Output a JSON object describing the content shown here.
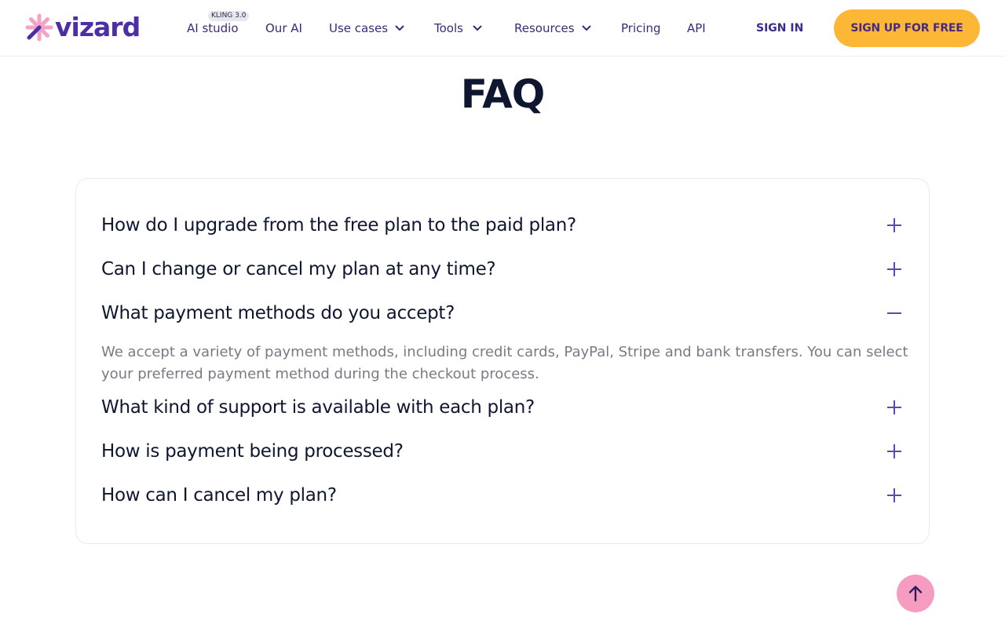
{
  "brand": {
    "name": "vizard",
    "logo_color": "#f3a3c4",
    "text_color": "#4b2ea8"
  },
  "nav": {
    "items": [
      {
        "label": "AI studio",
        "badge": "KLING 3.0",
        "has_dropdown": false
      },
      {
        "label": "Our AI",
        "has_dropdown": false
      },
      {
        "label": "Use cases",
        "has_dropdown": true
      },
      {
        "label": "Tools",
        "has_dropdown": true
      },
      {
        "label": "Resources",
        "has_dropdown": true
      },
      {
        "label": "Pricing",
        "has_dropdown": false
      },
      {
        "label": "API",
        "has_dropdown": false
      }
    ],
    "sign_in": "SIGN IN",
    "sign_up": "SIGN UP FOR FREE",
    "sign_up_color": "#fcb737"
  },
  "faq": {
    "title": "FAQ",
    "items": [
      {
        "question": "How do I upgrade from the free plan to the paid plan?",
        "expanded": false
      },
      {
        "question": "Can I change or cancel my plan at any time?",
        "expanded": false
      },
      {
        "question": "What payment methods do you accept?",
        "expanded": true,
        "answer": "We accept a variety of payment methods, including credit cards, PayPal, Stripe and bank transfers. You can select your preferred payment method during the checkout process."
      },
      {
        "question": "What kind of support is available with each plan?",
        "expanded": false
      },
      {
        "question": "How is payment being processed?",
        "expanded": false
      },
      {
        "question": "How can I cancel my plan?",
        "expanded": false
      }
    ],
    "icons": {
      "collapsed": "plus-icon",
      "expanded": "minus-icon"
    }
  },
  "scroll_top": {
    "icon": "arrow-up-icon",
    "color": "#f69cc1"
  }
}
